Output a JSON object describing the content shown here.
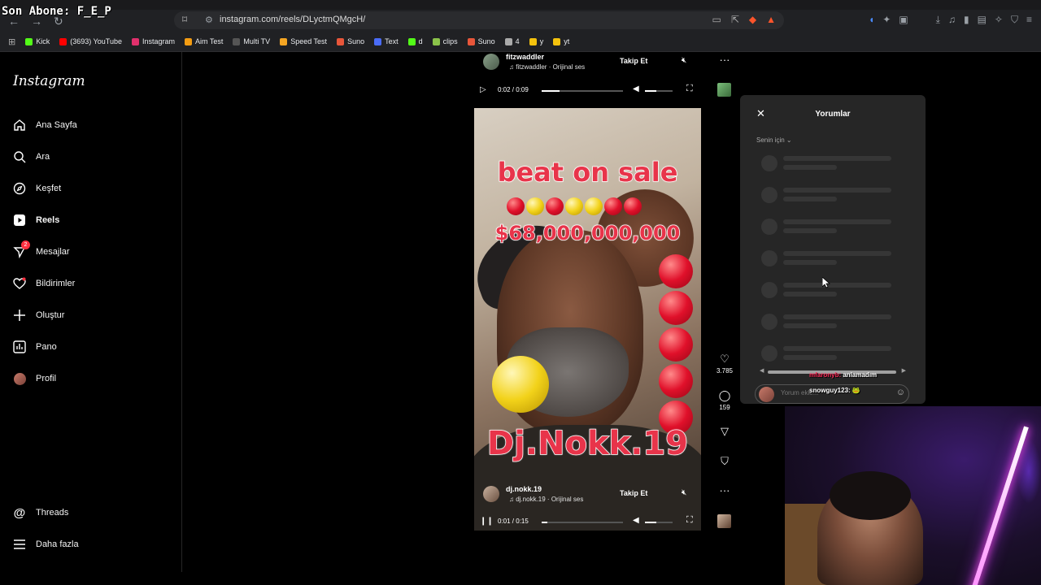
{
  "overlay_title": "Son Abone: F_E_P",
  "browser": {
    "url": "instagram.com/reels/DLyctmQMgcH/",
    "bookmarks": [
      {
        "label": "Kick",
        "color": "#53fc18"
      },
      {
        "label": "(3693) YouTube",
        "color": "#ff0000"
      },
      {
        "label": "Instagram",
        "color": "#e1306c"
      },
      {
        "label": "Aim Test",
        "color": "#f39c12"
      },
      {
        "label": "Multi TV",
        "color": "#555555"
      },
      {
        "label": "Speed Test",
        "color": "#f5a623"
      },
      {
        "label": "Suno",
        "color": "#e8563a"
      },
      {
        "label": "Text",
        "color": "#4a6cf7"
      },
      {
        "label": "d",
        "color": "#53fc18"
      },
      {
        "label": "clips",
        "color": "#8bc34a"
      },
      {
        "label": "Suno",
        "color": "#e8563a"
      },
      {
        "label": "4",
        "color": "#aaaaaa"
      },
      {
        "label": "y",
        "color": "#f4c20d"
      },
      {
        "label": "yt",
        "color": "#f4c20d"
      }
    ]
  },
  "sidebar": {
    "logo": "Instagram",
    "items": [
      {
        "label": "Ana Sayfa",
        "icon": "home-icon"
      },
      {
        "label": "Ara",
        "icon": "search-icon"
      },
      {
        "label": "Keşfet",
        "icon": "compass-icon"
      },
      {
        "label": "Reels",
        "icon": "reels-icon"
      },
      {
        "label": "Mesajlar",
        "icon": "messenger-icon",
        "badge": "2"
      },
      {
        "label": "Bildirimler",
        "icon": "heart-icon"
      },
      {
        "label": "Oluştur",
        "icon": "plus-icon"
      },
      {
        "label": "Pano",
        "icon": "dashboard-icon"
      },
      {
        "label": "Profil",
        "icon": "avatar"
      }
    ],
    "bottom": [
      {
        "label": "Threads",
        "icon": "threads-icon"
      },
      {
        "label": "Daha fazla",
        "icon": "menu-icon"
      }
    ]
  },
  "reel_top": {
    "username": "fitzwaddler",
    "audio": "fitzwaddler · Orijinal ses",
    "follow": "Takip Et",
    "time": "0:02 / 0:09",
    "progress": 0.22
  },
  "reel_main": {
    "text_top": "beat on sale",
    "text_price": "$68,000,000,000",
    "text_bottom": "Dj.Nokk.19",
    "username": "dj.nokk.19",
    "audio": "dj.nokk.19 · Orijinal ses",
    "follow": "Takip Et",
    "time": "0:01 / 0:15",
    "progress": 0.07
  },
  "actions": {
    "likes": "3.785",
    "comments": "159"
  },
  "comments_panel": {
    "title": "Yorumlar",
    "sort": "Senin için ⌄",
    "input_placeholder": "Yorum ekle..."
  },
  "stream_chat": [
    {
      "name": "mfaronyb:",
      "message": "anlamadım"
    },
    {
      "name": "snowguy123:",
      "message": "🐸"
    }
  ]
}
